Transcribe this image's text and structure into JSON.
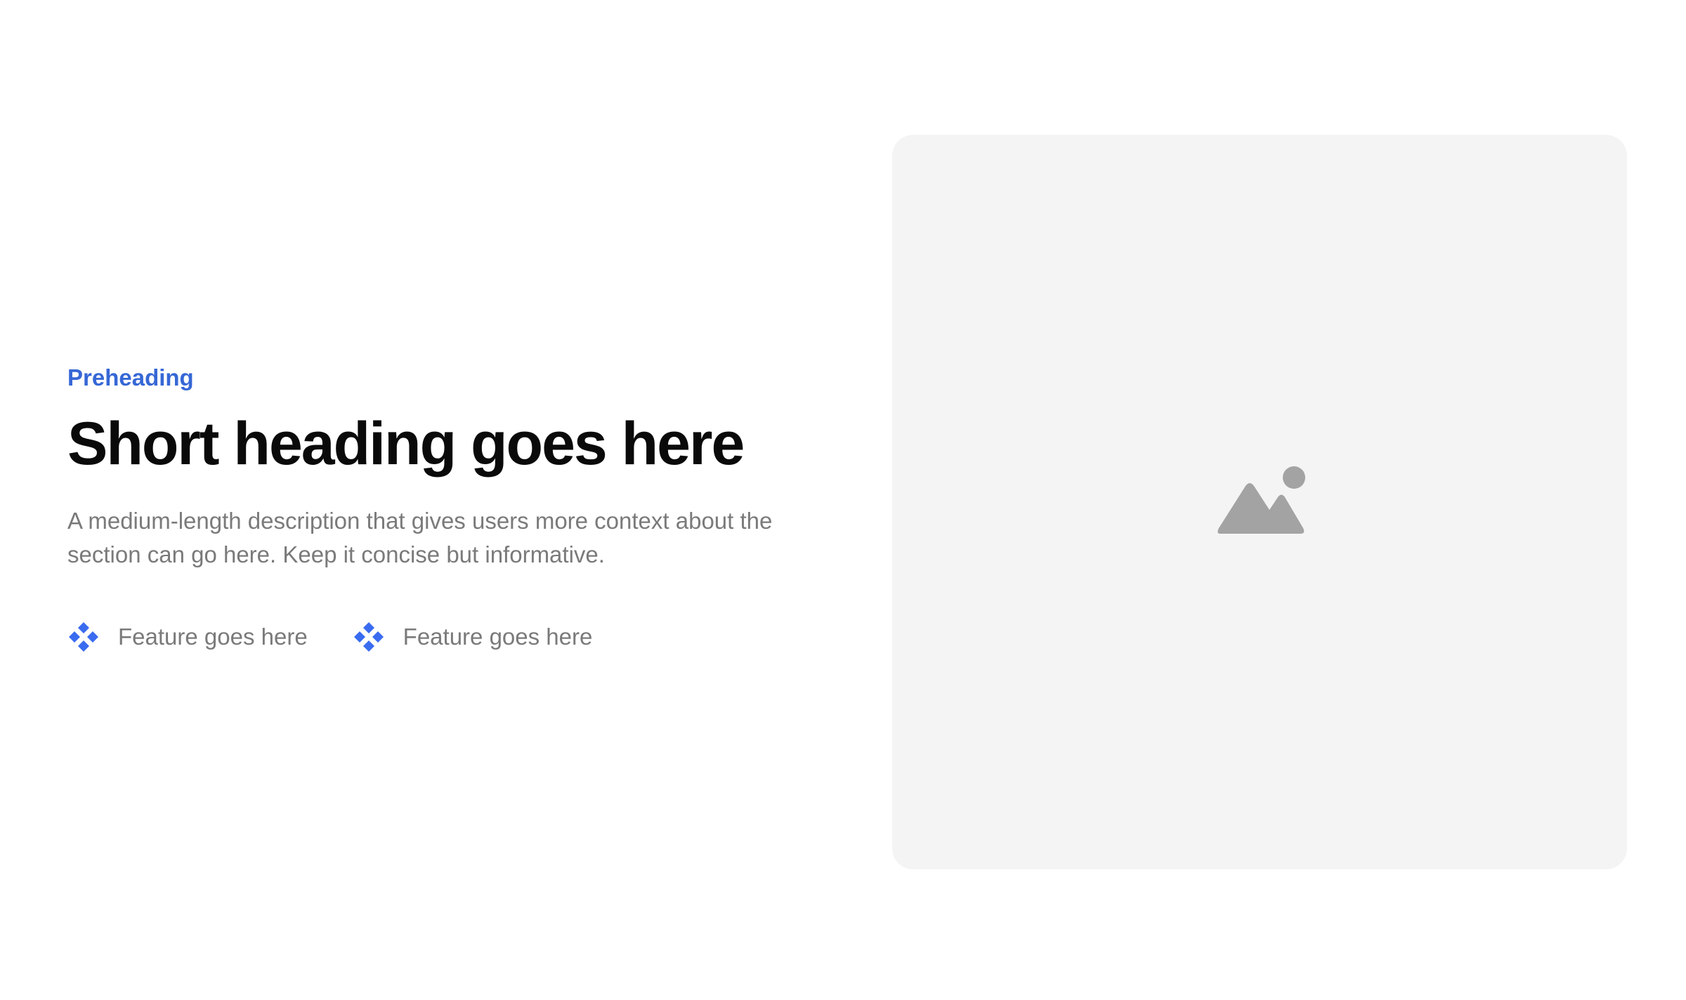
{
  "section": {
    "preheading": "Preheading",
    "heading": "Short heading goes here",
    "description": "A medium-length description that gives users more context about the section can go here. Keep it concise but informative.",
    "features": [
      {
        "icon": "diamond-grid-icon",
        "label": "Feature goes here"
      },
      {
        "icon": "diamond-grid-icon",
        "label": "Feature goes here"
      }
    ]
  },
  "media": {
    "icon": "image-placeholder-icon"
  },
  "colors": {
    "accent": "#3667d6",
    "heading": "#0a0a0a",
    "muted_text": "#7a7a7a",
    "card_background": "#f4f4f4",
    "placeholder_icon": "#a3a3a3"
  }
}
